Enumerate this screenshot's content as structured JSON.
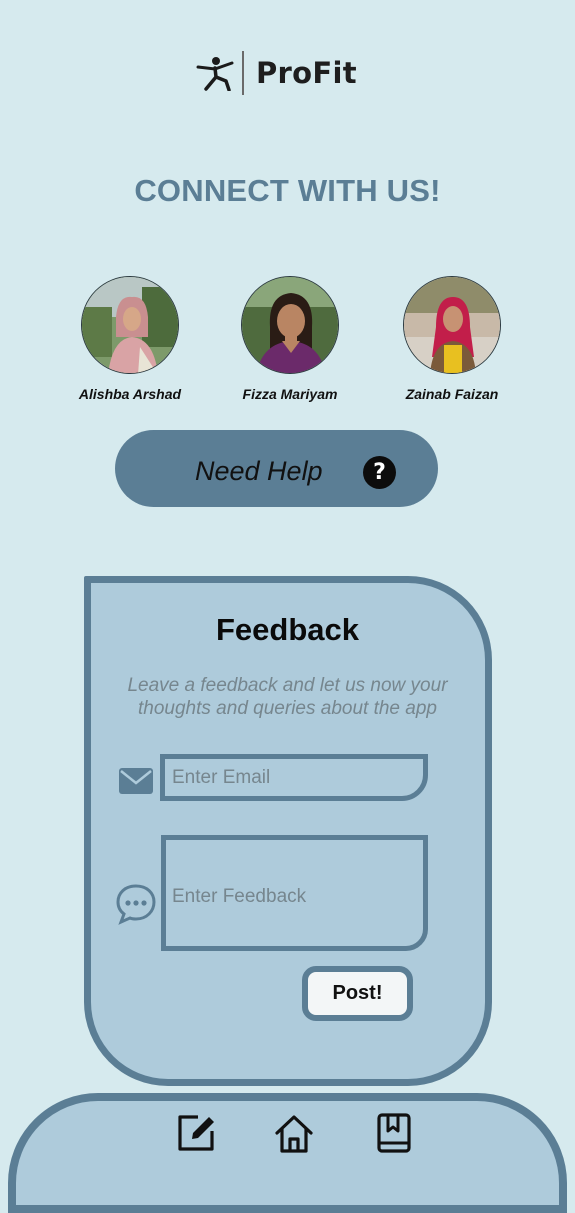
{
  "header": {
    "app_name": "ProFit",
    "logo_icon": "yoga-pose-icon"
  },
  "connect": {
    "title": "CONNECT WITH US!",
    "members": [
      {
        "name": "Alishba Arshad",
        "icon": "avatar-photo"
      },
      {
        "name": "Fizza Mariyam",
        "icon": "avatar-photo"
      },
      {
        "name": "Zainab Faizan",
        "icon": "avatar-photo"
      }
    ]
  },
  "help": {
    "label": "Need Help",
    "icon": "question-mark-icon",
    "icon_glyph": "?"
  },
  "feedback": {
    "title": "Feedback",
    "description": "Leave a feedback and let us now your thoughts and queries about the app",
    "email_placeholder": "Enter Email",
    "email_value": "",
    "email_icon": "mail-icon",
    "feedback_placeholder": "Enter Feedback",
    "feedback_value": "",
    "feedback_icon": "chat-bubble-icon",
    "submit_label": "Post!"
  },
  "bottom_nav": {
    "items": [
      {
        "icon": "edit-icon"
      },
      {
        "icon": "home-icon"
      },
      {
        "icon": "bookmark-book-icon"
      }
    ]
  },
  "colors": {
    "background": "#d6eaee",
    "accent": "#5b7e95",
    "card": "#aecbdb",
    "placeholder": "#76868e"
  }
}
